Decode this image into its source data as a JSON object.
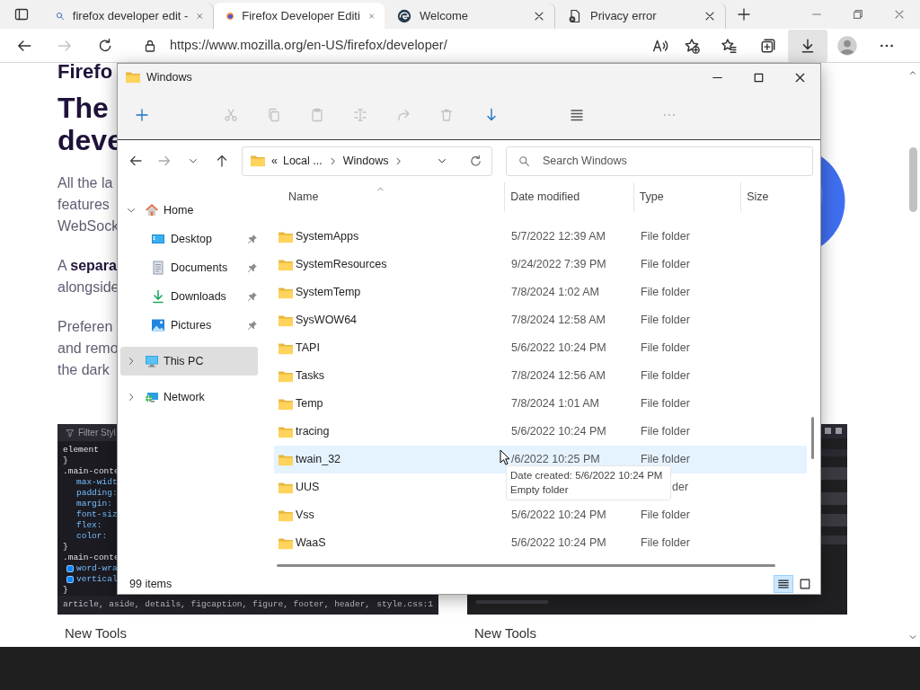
{
  "browser": {
    "tabs": [
      {
        "label": "firefox developer edit -",
        "kind": "search",
        "selected": false
      },
      {
        "label": "Firefox Developer Editi",
        "kind": "firefox",
        "selected": true
      },
      {
        "label": "Welcome",
        "kind": "edge",
        "selected": false
      },
      {
        "label": "Privacy error",
        "kind": "error",
        "selected": false
      }
    ],
    "address": {
      "url": "https://www.mozilla.org/en-US/firefox/developer/"
    },
    "forward_disabled": true,
    "downloads_open": true
  },
  "page": {
    "title_fragment": "Firefo",
    "headline": [
      "The",
      "deve"
    ],
    "paragraphs": [
      {
        "lines": [
          "All the la",
          "features",
          "WebSock"
        ]
      },
      {
        "lines": [
          "A **separa**",
          "alongside"
        ]
      },
      {
        "lines": [
          "Preferen",
          "and remo",
          "the dark"
        ]
      }
    ],
    "code_panel": {
      "title": "Filter Styl",
      "lines": [
        {
          "text": "element",
          "kind": "selector"
        },
        {
          "text": "}",
          "kind": "selector"
        },
        {
          "text": ".main-conte",
          "kind": "selector"
        },
        {
          "text": "max-widt",
          "kind": "property"
        },
        {
          "text": "padding:",
          "kind": "property"
        },
        {
          "text": "margin:",
          "kind": "property"
        },
        {
          "text": "font-siz",
          "kind": "property"
        },
        {
          "text": "flex:",
          "kind": "property"
        },
        {
          "text": "color:",
          "kind": "property"
        },
        {
          "text": "}",
          "kind": "selector"
        },
        {
          "text": ".main-conte",
          "kind": "selector"
        },
        {
          "text": "word-wra",
          "kind": "checkbox",
          "checked": true
        },
        {
          "text": "vertical",
          "kind": "checkbox",
          "checked": true
        },
        {
          "text": "}",
          "kind": "selector"
        }
      ],
      "footer": "article, aside, details, figcaption, figure, footer, header,",
      "source": "style.css:1"
    },
    "captions": [
      "New Tools",
      "New Tools"
    ]
  },
  "explorer": {
    "title": "Windows",
    "commands": [
      {
        "kind": "new",
        "disabled": false
      },
      {
        "kind": "cut",
        "disabled": true
      },
      {
        "kind": "copy",
        "disabled": true
      },
      {
        "kind": "paste",
        "disabled": true
      },
      {
        "kind": "rename",
        "disabled": true
      },
      {
        "kind": "share",
        "disabled": true
      },
      {
        "kind": "delete",
        "disabled": true
      },
      {
        "kind": "sort",
        "disabled": false
      },
      {
        "kind": "view",
        "disabled": false
      },
      {
        "kind": "more",
        "disabled": true
      }
    ],
    "breadcrumb": {
      "overflow": "«",
      "items": [
        "Local ...",
        "Windows"
      ]
    },
    "search": {
      "placeholder": "Search Windows"
    },
    "nav": [
      {
        "label": "Home",
        "kind": "home",
        "expanded": true,
        "selected": false,
        "children": [
          {
            "label": "Desktop",
            "kind": "desktop",
            "pinned": true,
            "selected": false
          },
          {
            "label": "Documents",
            "kind": "documents",
            "pinned": true,
            "selected": false
          },
          {
            "label": "Downloads",
            "kind": "downloads",
            "pinned": true,
            "selected": false
          },
          {
            "label": "Pictures",
            "kind": "pictures",
            "pinned": true,
            "selected": false
          }
        ]
      },
      {
        "label": "This PC",
        "kind": "pc",
        "expanded": false,
        "selected": true
      },
      {
        "label": "Network",
        "kind": "network",
        "expanded": false,
        "selected": false
      }
    ],
    "columns": [
      {
        "label": "Name",
        "sorted": true
      },
      {
        "label": "Date modified",
        "sorted": false
      },
      {
        "label": "Type",
        "sorted": false
      },
      {
        "label": "Size",
        "sorted": false
      }
    ],
    "rows": [
      {
        "name": "SystemApps",
        "date": "5/7/2022 12:39 AM",
        "type": "File folder",
        "hovered": false
      },
      {
        "name": "SystemResources",
        "date": "9/24/2022 7:39 PM",
        "type": "File folder",
        "hovered": false
      },
      {
        "name": "SystemTemp",
        "date": "7/8/2024 1:02 AM",
        "type": "File folder",
        "hovered": false
      },
      {
        "name": "SysWOW64",
        "date": "7/8/2024 12:58 AM",
        "type": "File folder",
        "hovered": false
      },
      {
        "name": "TAPI",
        "date": "5/6/2022 10:24 PM",
        "type": "File folder",
        "hovered": false
      },
      {
        "name": "Tasks",
        "date": "7/8/2024 12:56 AM",
        "type": "File folder",
        "hovered": false
      },
      {
        "name": "Temp",
        "date": "7/8/2024 1:01 AM",
        "type": "File folder",
        "hovered": false
      },
      {
        "name": "tracing",
        "date": "5/6/2022 10:24 PM",
        "type": "File folder",
        "hovered": false
      },
      {
        "name": "twain_32",
        "date": "/6/2022 10:25 PM",
        "type": "File folder",
        "hovered": true
      },
      {
        "name": "UUS",
        "type": "der",
        "hovered": false
      },
      {
        "name": "Vss",
        "date": "5/6/2022 10:24 PM",
        "type": "File folder",
        "hovered": false
      },
      {
        "name": "WaaS",
        "date": "5/6/2022 10:24 PM",
        "type": "File folder",
        "hovered": false
      }
    ],
    "status": "99 items",
    "views": [
      {
        "kind": "details",
        "selected": true
      },
      {
        "kind": "tiles",
        "selected": false
      }
    ]
  },
  "tooltip": {
    "lines": [
      "Date created: 5/6/2022 10:24 PM",
      "Empty folder"
    ]
  }
}
